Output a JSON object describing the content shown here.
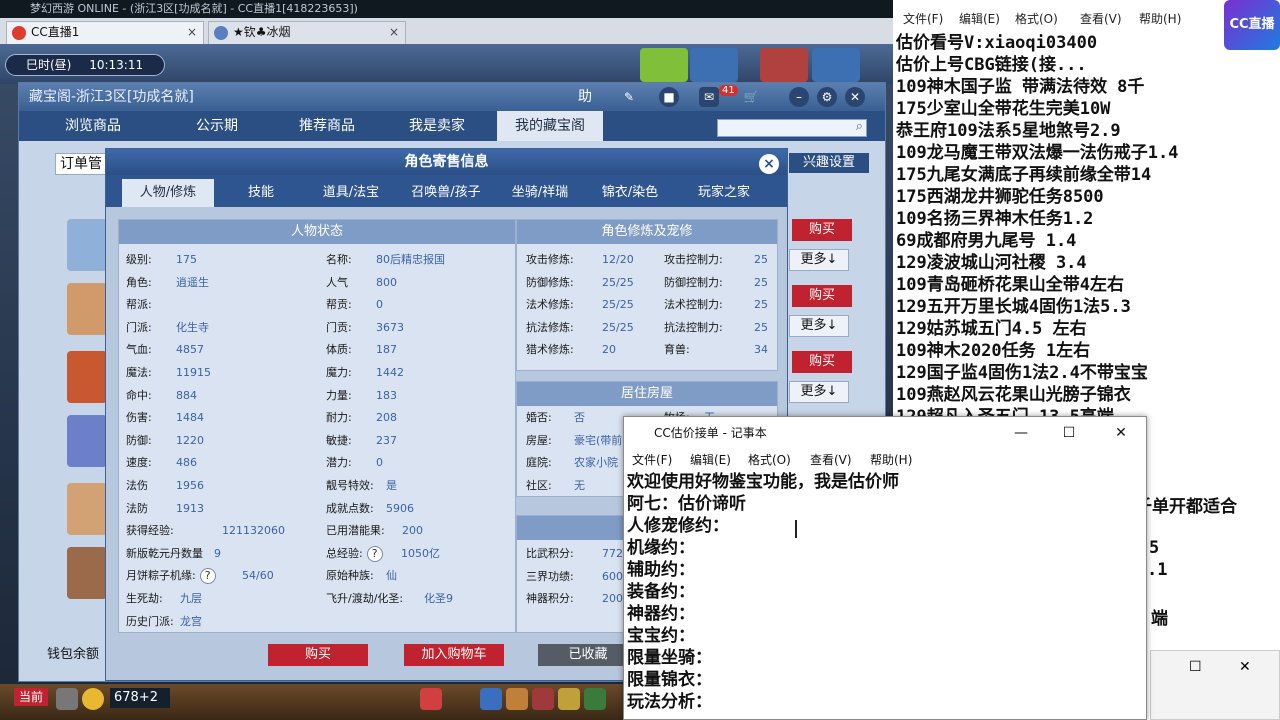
{
  "browser": {
    "window_title": "梦幻西游 ONLINE - (浙江3区[功成名就] - CC直播1[418223653])",
    "tabs": [
      {
        "label": "CC直播1",
        "close": "×"
      },
      {
        "label": "★钦♣冰烟",
        "close": "×"
      }
    ]
  },
  "game": {
    "time_period": "巳时(昼)",
    "clock": "10:13:11"
  },
  "cbg": {
    "title": "藏宝阁-浙江3区[功成名就]",
    "help_label": "助",
    "badge": "41",
    "nav": [
      "浏览商品",
      "公示期",
      "推荐商品",
      "我是卖家",
      "我的藏宝阁"
    ],
    "order_label": "订单管",
    "interest_label": "兴趣设置",
    "buy_label": "购买",
    "more_label": "更多↓",
    "wallet_label": "钱包余额"
  },
  "role": {
    "title": "角色寄售信息",
    "close": "×",
    "tabs": [
      "人物/修炼",
      "技能",
      "道具/法宝",
      "召唤兽/孩子",
      "坐骑/祥瑞",
      "锦衣/染色",
      "玩家之家"
    ],
    "status_header": "人物状态",
    "cultivation_header": "角色修炼及宠修",
    "house_header": "居住房屋",
    "left_col": [
      {
        "label": "级别:",
        "value": "175"
      },
      {
        "label": "角色:",
        "value": "逍遥生"
      },
      {
        "label": "帮派:",
        "value": ""
      },
      {
        "label": "门派:",
        "value": "化生寺"
      },
      {
        "label": "气血:",
        "value": "4857"
      },
      {
        "label": "魔法:",
        "value": "11915"
      },
      {
        "label": "命中:",
        "value": "884"
      },
      {
        "label": "伤害:",
        "value": "1484"
      },
      {
        "label": "防御:",
        "value": "1220"
      },
      {
        "label": "速度:",
        "value": "486"
      },
      {
        "label": "法伤",
        "value": "1956"
      },
      {
        "label": "法防",
        "value": "1913"
      },
      {
        "label": "获得经验:",
        "value": "121132060"
      },
      {
        "label": "新版乾元丹数量",
        "value": "9"
      },
      {
        "label": "月饼粽子机缘:",
        "value": "54/60"
      },
      {
        "label": "生死劫:",
        "value": "九层"
      },
      {
        "label": "历史门派:",
        "value": "龙宫"
      }
    ],
    "right_col": [
      {
        "label": "名称:",
        "value": "80后精忠报国"
      },
      {
        "label": "人气",
        "value": "800"
      },
      {
        "label": "帮贡:",
        "value": "0"
      },
      {
        "label": "门贡:",
        "value": "3673"
      },
      {
        "label": "体质:",
        "value": "187"
      },
      {
        "label": "魔力:",
        "value": "1442"
      },
      {
        "label": "力量:",
        "value": "183"
      },
      {
        "label": "耐力:",
        "value": "208"
      },
      {
        "label": "敏捷:",
        "value": "237"
      },
      {
        "label": "潜力:",
        "value": "0"
      },
      {
        "label": "靓号特效:",
        "value": "是"
      },
      {
        "label": "成就点数:",
        "value": "5906"
      },
      {
        "label": "已用潜能果:",
        "value": "200"
      },
      {
        "label": "总经验:",
        "value": "1050亿"
      },
      {
        "label": "原始种族:",
        "value": "仙"
      },
      {
        "label": "飞升/渡劫/化圣:",
        "value": "化圣9"
      }
    ],
    "cult": [
      {
        "l1": "攻击修炼:",
        "v1": "12/20",
        "l2": "攻击控制力:",
        "v2": "25"
      },
      {
        "l1": "防御修炼:",
        "v1": "25/25",
        "l2": "防御控制力:",
        "v2": "25"
      },
      {
        "l1": "法术修炼:",
        "v1": "25/25",
        "l2": "法术控制力:",
        "v2": "25"
      },
      {
        "l1": "抗法修炼:",
        "v1": "25/25",
        "l2": "抗法控制力:",
        "v2": "25"
      },
      {
        "l1": "猎术修炼:",
        "v1": "20",
        "l2": "育兽:",
        "v2": "34"
      }
    ],
    "house": [
      {
        "label": "婚否:",
        "value": "否"
      },
      {
        "label": "房屋:",
        "value": "豪宅(带前"
      },
      {
        "label": "庭院:",
        "value": "农家小院"
      },
      {
        "label": "社区:",
        "value": "无"
      }
    ],
    "house_right_label": "牧场:",
    "house_right_value": "无",
    "bottom_panel": [
      {
        "label": "比武积分:",
        "value": "772"
      },
      {
        "label": "三界功绩:",
        "value": "600"
      },
      {
        "label": "神器积分:",
        "value": "200"
      }
    ],
    "qmark": "?",
    "buttons": {
      "buy": "购买",
      "cart": "加入购物车",
      "saved": "已收藏"
    }
  },
  "taskbar": {
    "current_label": "当前",
    "coord": "678+2"
  },
  "right_notes": {
    "menu": [
      "文件(F)",
      "编辑(E)",
      "格式(O)",
      "查看(V)",
      "帮助(H)"
    ],
    "logo": "CC直播",
    "lines": [
      "估价看号V:xiaoqi03400",
      "估价上号CBG链接(接...",
      "109神木国子监 带满法待效 8千",
      "175少室山全带花生完美10W",
      "恭王府109法系5星地煞号2.9",
      "109龙马魔王带双法爆一法伤戒子1.4",
      "175九尾女满底子再续前缘全带14",
      "175西湖龙井狮驼任务8500",
      "109名扬三界神木任务1.2",
      "69成都府男九尾号  1.4",
      "129凌波城山河社稷  3.4",
      "109青岛砸桥花果山全带4左右",
      "129五开万里长城4固伤1法5.3",
      "129姑苏城五门4.5 左右",
      "109神木2020任务  1左右",
      "129国子监4固伤1法2.4不带宝宝",
      "109燕赵风云花果山光膀子锦衣",
      "129超凡入圣五门  13.5高端"
    ],
    "frag1": "千单开都适合",
    "frag2": "5",
    "frag3": ".1",
    "frag4": "端"
  },
  "notepad": {
    "title": "CC估价接单 - 记事本",
    "menu": [
      "文件(F)",
      "编辑(E)",
      "格式(O)",
      "查看(V)",
      "帮助(H)"
    ],
    "ctrl": [
      "—",
      "☐",
      "✕"
    ],
    "lines": [
      "欢迎使用好物鉴宝功能，我是估价师",
      "阿七：估价谛听",
      "人修宠修约：",
      "机缘约：",
      "辅助约：",
      "装备约：",
      "神器约：",
      "宝宝约：",
      "限量坐骑：",
      "限量锦衣：",
      "玩法分析："
    ]
  }
}
